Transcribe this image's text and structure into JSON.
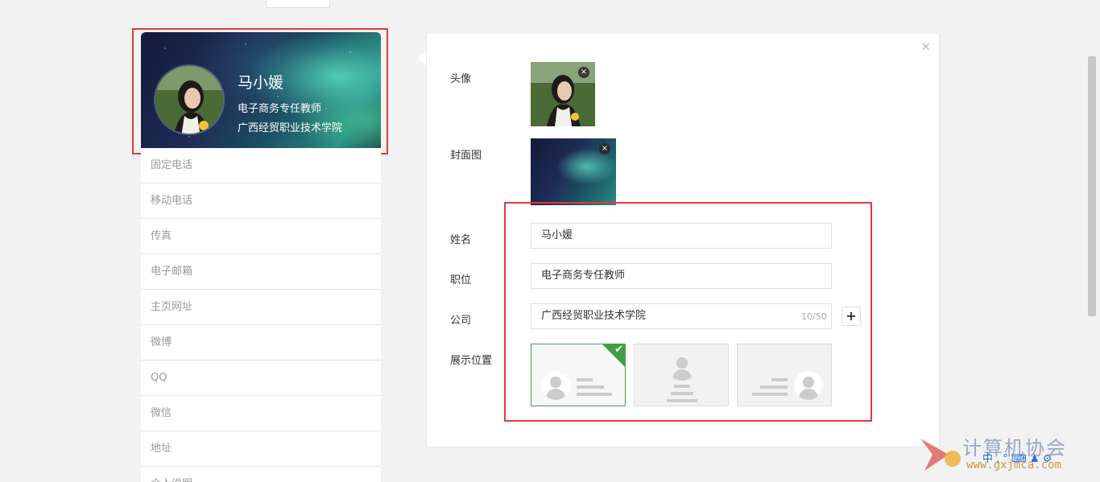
{
  "profile_card": {
    "name": "马小媛",
    "title": "电子商务专任教师",
    "company": "广西经贸职业技术学院"
  },
  "field_list": {
    "items": [
      "固定电话",
      "移动电话",
      "传真",
      "电子邮箱",
      "主页网址",
      "微博",
      "QQ",
      "微信",
      "地址",
      "个人说明"
    ]
  },
  "edit_panel": {
    "close_label": "×",
    "avatar_label": "头像",
    "cover_label": "封面图",
    "remove_label": "×",
    "name_label": "姓名",
    "name_value": "马小媛",
    "position_label": "职位",
    "position_value": "电子商务专任教师",
    "company_label": "公司",
    "company_value": "广西经贸职业技术学院",
    "company_char_count": "10/50",
    "add_company_label": "+",
    "display_position_label": "展示位置",
    "display_options": [
      "left",
      "center",
      "right"
    ],
    "selected_option": "left"
  },
  "watermark": {
    "text": "计算机协会",
    "url": "www.gxjmca.com",
    "ime": "中 , ° ⌨ ♟ ⚙"
  },
  "colors": {
    "accent_green": "#43a047",
    "annotation_red": "#e53935"
  }
}
